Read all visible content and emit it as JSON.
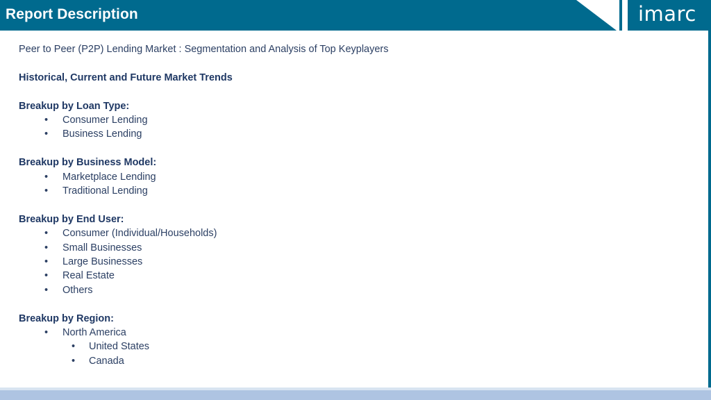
{
  "header": {
    "title": "Report Description",
    "logo_text": "imarc"
  },
  "colors": {
    "brand": "#006a8e",
    "heading_text": "#1f3864",
    "bottom_band": "#aec4e2"
  },
  "intro": "Peer to Peer (P2P) Lending Market : Segmentation and Analysis of Top Keyplayers",
  "trends_heading": "Historical, Current and Future Market Trends",
  "sections": [
    {
      "heading": "Breakup by Loan Type:",
      "items": [
        "Consumer Lending",
        "Business Lending"
      ]
    },
    {
      "heading": "Breakup by Business Model:",
      "items": [
        "Marketplace Lending",
        "Traditional Lending"
      ]
    },
    {
      "heading": "Breakup by End User:",
      "items": [
        "Consumer (Individual/Households)",
        "Small Businesses",
        "Large Businesses",
        "Real Estate",
        "Others"
      ]
    },
    {
      "heading": "Breakup by Region:",
      "items": [
        "North America"
      ],
      "subitems": [
        "United States",
        "Canada"
      ]
    }
  ],
  "bullet_glyph": "•"
}
